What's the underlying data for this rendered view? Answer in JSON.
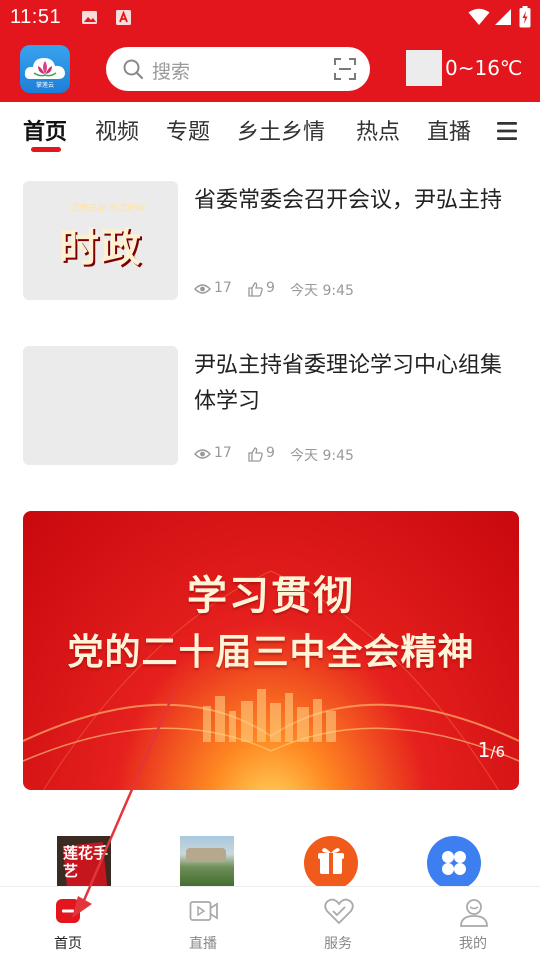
{
  "status_bar": {
    "time": "11:51"
  },
  "header": {
    "app_logo_label": "掌莲云",
    "search_placeholder": "搜索",
    "temperature": "0~16℃"
  },
  "tabs": [
    {
      "label": "首页",
      "active": true
    },
    {
      "label": "视频",
      "active": false
    },
    {
      "label": "专题",
      "active": false
    },
    {
      "label": "乡土乡情",
      "active": false
    },
    {
      "label": "热点",
      "active": false
    },
    {
      "label": "直播",
      "active": false
    }
  ],
  "articles": [
    {
      "title": "省委常委会召开会议，尹弘主持",
      "thumb_line1": "江西日报  大江新闻",
      "thumb_line2": "时政",
      "views": "17",
      "likes": "9",
      "time": "今天 9:45"
    },
    {
      "title": "尹弘主持省委理论学习中心组集体学习",
      "views": "17",
      "likes": "9",
      "time": "今天 9:45"
    }
  ],
  "banner": {
    "line1": "学习贯彻",
    "line2": "党的二十届三中全会精神",
    "page_current": "1",
    "page_total": "/6"
  },
  "shortcuts": [
    {
      "icon": "lianhua-shouyi-thumb",
      "text": "莲花手艺"
    },
    {
      "icon": "landscape-thumb"
    },
    {
      "icon": "gift-icon"
    },
    {
      "icon": "apps-icon"
    }
  ],
  "bottom_nav": [
    {
      "label": "首页",
      "icon": "home-icon",
      "active": true
    },
    {
      "label": "直播",
      "icon": "live-video-icon",
      "active": false
    },
    {
      "label": "服务",
      "icon": "service-heart-icon",
      "active": false
    },
    {
      "label": "我的",
      "icon": "profile-icon",
      "active": false
    }
  ],
  "colors": {
    "brand_red": "#e3161e",
    "muted_gray": "#999999"
  }
}
